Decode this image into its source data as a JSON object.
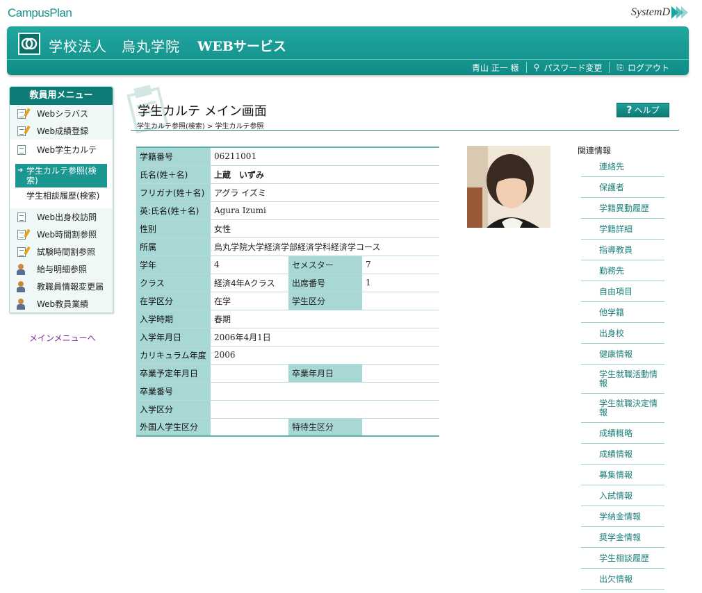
{
  "brand": {
    "campus_logo": "CampusPlan",
    "system_logo": "SystemD"
  },
  "header": {
    "school_name": "学校法人　烏丸学院",
    "service_name": "WEBサービス",
    "user": "青山 正一 様",
    "password_change": "パスワード変更",
    "logout": "ログアウト"
  },
  "menu": {
    "title": "教員用メニュー",
    "items": [
      {
        "label": "Webシラバス",
        "icon": "document-pen-icon"
      },
      {
        "label": "Web成績登録",
        "icon": "document-pen-icon"
      },
      {
        "label": "Web学生カルテ",
        "icon": "document-icon"
      },
      {
        "label": "Web出身校訪問",
        "icon": "document-icon"
      },
      {
        "label": "Web時間割参照",
        "icon": "document-pen-icon"
      },
      {
        "label": "試験時間割参照",
        "icon": "document-pen-icon"
      },
      {
        "label": "給与明細参照",
        "icon": "person-icon"
      },
      {
        "label": "教職員情報変更届",
        "icon": "person-icon"
      },
      {
        "label": "Web教員業績",
        "icon": "person-icon"
      }
    ],
    "submenu": [
      {
        "label": "学生カルテ参照(検索)",
        "selected": true
      },
      {
        "label": "学生相談履歴(検索)",
        "selected": false
      }
    ],
    "main_menu_link": "メインメニューへ"
  },
  "page": {
    "title": "学生カルテ メイン画面",
    "breadcrumb": "学生カルテ参照(検索) > 学生カルテ参照",
    "help_label": "ヘルプ",
    "help_icon": "question-icon"
  },
  "student": {
    "id_label": "学籍番号",
    "id": "06211001",
    "name_label": "氏名(姓＋名)",
    "name": "上蔵　いずみ",
    "kana_label": "フリガナ(姓＋名)",
    "kana": "アグラ イズミ",
    "en_label": "英:氏名(姓＋名)",
    "en": "Agura Izumi",
    "gender_label": "性別",
    "gender": "女性",
    "affil_label": "所属",
    "affil": "烏丸学院大学経済学部経済学科経済学コース",
    "year_label": "学年",
    "year": "4",
    "semester_label": "セメスター",
    "semester": "7",
    "class_label": "クラス",
    "class": "経済4年Aクラス",
    "seat_label": "出席番号",
    "seat": "1",
    "status_label": "在学区分",
    "status": "在学",
    "stype_label": "学生区分",
    "stype": "",
    "entry_term_label": "入学時期",
    "entry_term": "春期",
    "entry_date_label": "入学年月日",
    "entry_date": "2006年4月1日",
    "curriculum_label": "カリキュラム年度",
    "curriculum": "2006",
    "grad_plan_label": "卒業予定年月日",
    "grad_plan": "",
    "grad_date_label": "卒業年月日",
    "grad_date": "",
    "grad_no_label": "卒業番号",
    "grad_no": "",
    "entry_type_label": "入学区分",
    "entry_type": "",
    "foreign_label": "外国人学生区分",
    "foreign": "",
    "special_label": "特待生区分",
    "special": ""
  },
  "related": {
    "title": "関連情報",
    "links": [
      "連絡先",
      "保護者",
      "学籍異動履歴",
      "学籍詳細",
      "指導教員",
      "勤務先",
      "自由項目",
      "他学籍",
      "出身校",
      "健康情報",
      "学生就職活動情報",
      "学生就職決定情報",
      "成績概略",
      "成績情報",
      "募集情報",
      "入試情報",
      "学納金情報",
      "奨学金情報",
      "学生相談履歴",
      "出欠情報"
    ]
  },
  "colors": {
    "accent": "#0f8c85",
    "label_bg": "#a8d8d5",
    "link": "#1b7f79"
  }
}
